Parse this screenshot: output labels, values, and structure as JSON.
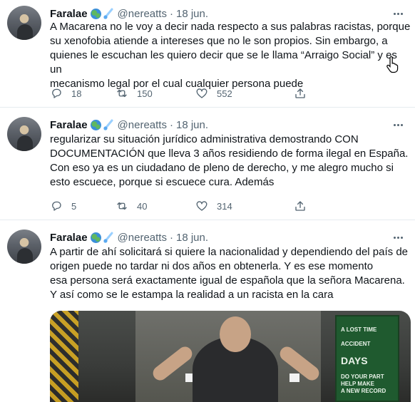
{
  "colors": {
    "text": "#0f1419",
    "muted": "#536471",
    "divider": "#e6ecf0"
  },
  "icons": {
    "reply": "reply-icon",
    "retweet": "retweet-icon",
    "like": "heart-icon",
    "share": "share-icon",
    "more": "more-icon",
    "badge_1": "globe-emoji",
    "badge_2": "comet-emoji"
  },
  "tweets": [
    {
      "name": "Faralae",
      "handle": "@nereatts",
      "separator": "·",
      "date": "18 jun.",
      "text": "A Macarena no le voy a decir nada respecto a sus palabras racistas, porque\nsu xenofobia atiende a intereses que no le son propios. Sin embargo, a\nquienes le escuchan les quiero decir que se le llama “Arraigo Social” y es un\nmecanismo legal por el cual cualquier persona puede",
      "replies": "18",
      "retweets": "150",
      "likes": "552"
    },
    {
      "name": "Faralae",
      "handle": "@nereatts",
      "separator": "·",
      "date": "18 jun.",
      "text": "regularizar su situación jurídico administrativa demostrando CON\nDOCUMENTACIÓN que lleva 3 años residiendo de forma ilegal en España.\nCon eso ya es un ciudadano de pleno de derecho, y me alegro mucho si\nesto escuece, porque si escuece cura. Además",
      "replies": "5",
      "retweets": "40",
      "likes": "314"
    },
    {
      "name": "Faralae",
      "handle": "@nereatts",
      "separator": "·",
      "date": "18 jun.",
      "text": "A partir de ahí solicitará si quiere la nacionalidad y dependiendo del país de\norigen puede no tardar ni dos años en obtenerla. Y es ese momento\n esa persona será exactamente igual de española que la señora Macarena.\nY así como se le estampa la realidad a un racista en la cara",
      "media": {
        "sign_line_1": "A LOST TIME",
        "sign_line_2": "ACCIDENT",
        "sign_line_3": "DAYS",
        "sign_line_4": "DO YOUR PART\nHELP MAKE\nA NEW RECORD"
      }
    }
  ]
}
